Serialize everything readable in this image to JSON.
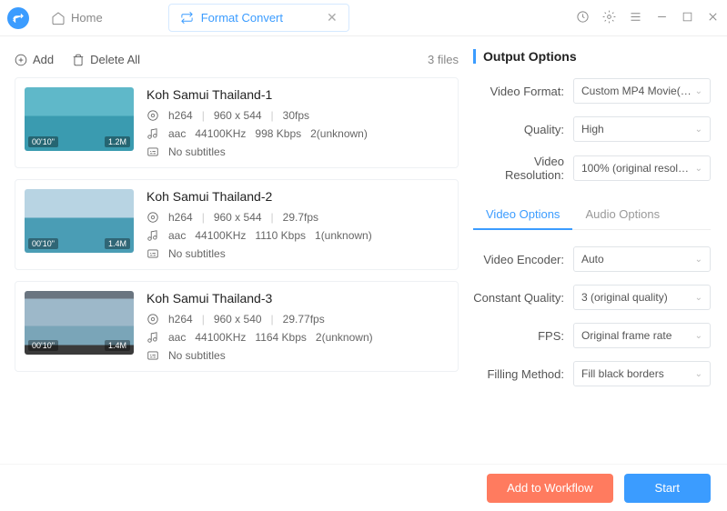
{
  "titlebar": {
    "home": "Home",
    "format_convert": "Format Convert"
  },
  "toolbar": {
    "add": "Add",
    "delete_all": "Delete All",
    "files_count": "3 files"
  },
  "files": [
    {
      "name": "Koh Samui Thailand-1",
      "duration": "00'10\"",
      "size": "1.2M",
      "vcodec": "h264",
      "res": "960   x   544",
      "fps": "30fps",
      "acodec": "aac",
      "arate": "44100KHz",
      "bitrate": "998 Kbps",
      "channels": "2(unknown)",
      "subs": "No subtitles",
      "sky": "#5fb8c9",
      "sea": "#3a9bb0"
    },
    {
      "name": "Koh Samui Thailand-2",
      "duration": "00'10\"",
      "size": "1.4M",
      "vcodec": "h264",
      "res": "960   x   544",
      "fps": "29.7fps",
      "acodec": "aac",
      "arate": "44100KHz",
      "bitrate": "1110 Kbps",
      "channels": "1(unknown)",
      "subs": "No subtitles",
      "sky": "#b8d4e3",
      "sea": "#4a9db5"
    },
    {
      "name": "Koh Samui Thailand-3",
      "duration": "00'10\"",
      "size": "1.4M",
      "vcodec": "h264",
      "res": "960   x   540",
      "fps": "29.77fps",
      "acodec": "aac",
      "arate": "44100KHz",
      "bitrate": "1164 Kbps",
      "channels": "2(unknown)",
      "subs": "No subtitles",
      "sky": "#9db8c9",
      "sea": "#7aa5b8"
    }
  ],
  "output": {
    "title": "Output Options",
    "video_format_label": "Video Format:",
    "video_format": "Custom MP4 Movie(…",
    "quality_label": "Quality:",
    "quality": "High",
    "resolution_label": "Video Resolution:",
    "resolution": "100% (original resol…"
  },
  "tabs": {
    "video": "Video Options",
    "audio": "Audio Options"
  },
  "video_opts": {
    "encoder_label": "Video Encoder:",
    "encoder": "Auto",
    "cq_label": "Constant Quality:",
    "cq": "3 (original quality)",
    "fps_label": "FPS:",
    "fps": "Original frame rate",
    "fill_label": "Filling Method:",
    "fill": "Fill black borders"
  },
  "footer": {
    "workflow": "Add to Workflow",
    "start": "Start"
  }
}
